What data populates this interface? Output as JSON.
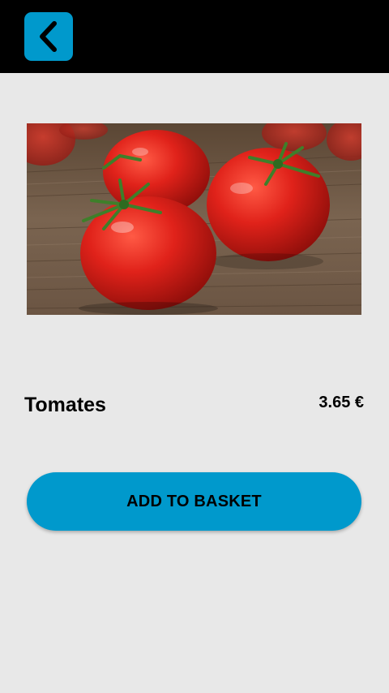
{
  "header": {
    "back_icon": "chevron-left-icon",
    "accent_color": "#0099cc"
  },
  "product": {
    "image_alt": "tomatoes-photo",
    "name": "Tomates",
    "price": "3.65 €"
  },
  "actions": {
    "add_to_basket_label": "ADD TO BASKET"
  }
}
